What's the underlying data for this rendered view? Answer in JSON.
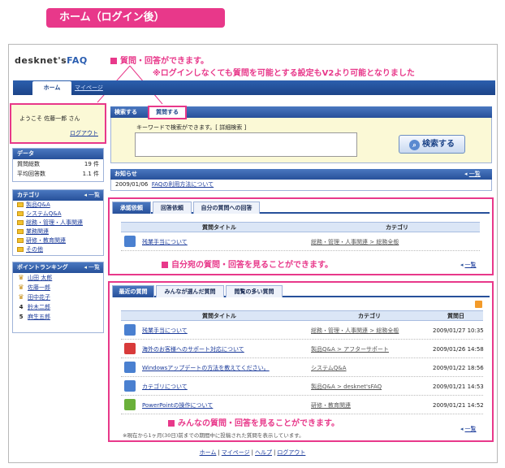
{
  "page_title": "ホーム（ログイン後）",
  "logo": {
    "main": "desknet's",
    "faq": "FAQ"
  },
  "callout_top": {
    "line1": "質問・回答ができます。",
    "line2": "※ログインしなくても質問を可能とする設定もV2より可能となりました"
  },
  "nav": {
    "home": "ホーム",
    "mypage": "マイページ"
  },
  "welcome": {
    "message": "ようこそ 佐藤一郎 さん",
    "logout": "ログアウト"
  },
  "data_panel": {
    "title": "データ",
    "rows": [
      {
        "label": "質問総数",
        "value": "19 件"
      },
      {
        "label": "平均回答数",
        "value": "1.1 件"
      }
    ]
  },
  "category_panel": {
    "title": "カテゴリ",
    "more": "一覧",
    "items": [
      "製品Q&A",
      "システムQ&A",
      "総務・管理・人事関連",
      "業務関連",
      "研修・教育関連",
      "その他"
    ]
  },
  "ranking_panel": {
    "title": "ポイントランキング",
    "more": "一覧",
    "items": [
      {
        "rank": "1",
        "name": "山田 太郎"
      },
      {
        "rank": "2",
        "name": "佐藤一郎"
      },
      {
        "rank": "3",
        "name": "田中花子"
      },
      {
        "rank": "4",
        "name": "鈴木二郎"
      },
      {
        "rank": "5",
        "name": "麻生五郎"
      }
    ]
  },
  "search": {
    "tab_search": "検索する",
    "tab_ask": "質問する",
    "hint": "キーワードで検索ができます。[ 詳細検索 ]",
    "button": "検索する"
  },
  "notice": {
    "title": "お知らせ",
    "more": "一覧",
    "date": "2009/01/06",
    "text": "FAQの利用方法について"
  },
  "box1": {
    "tabs": [
      "承認依頼",
      "回答依頼",
      "自分の質問への回答"
    ],
    "col_title": "質問タイトル",
    "col_category": "カテゴリ",
    "rows": [
      {
        "title": "残業手当について",
        "category": "総務・管理・人事関連 > 総務全般"
      }
    ],
    "callout": "自分宛の質問・回答を見ることができます。",
    "more": "一覧"
  },
  "box2": {
    "tabs": [
      "最近の質問",
      "みんなが選んだ質問",
      "閲覧の多い質問"
    ],
    "col_title": "質問タイトル",
    "col_category": "カテゴリ",
    "col_date": "質問日",
    "rows": [
      {
        "title": "残業手当について",
        "category": "総務・管理・人事関連 > 総務全般",
        "date": "2009/01/27 10:35",
        "icon_color": "#4a80d0"
      },
      {
        "title": "海外のお客様へのサポート対応について",
        "category": "製品Q&A > アフターサポート",
        "date": "2009/01/26 14:58",
        "icon_color": "#d83a3a"
      },
      {
        "title": "Windowsアップデートの方法を教えてください。",
        "category": "システムQ&A",
        "date": "2009/01/22 18:56",
        "icon_color": "#4a80d0"
      },
      {
        "title": "カテゴリについて",
        "category": "製品Q&A > desknet'sFAQ",
        "date": "2009/01/21 14:53",
        "icon_color": "#4a80d0"
      },
      {
        "title": "PowerPointの操作について",
        "category": "研修・教育関連",
        "date": "2009/01/21 14:52",
        "icon_color": "#6ab03a"
      }
    ],
    "callout": "みんなの質問・回答を見ることができます。",
    "note": "※現在から1ヶ月(30日)前までの期間中に投稿された質問を表示しています。",
    "more": "一覧"
  },
  "footer": [
    "ホーム",
    "マイページ",
    "ヘルプ",
    "ログアウト"
  ]
}
